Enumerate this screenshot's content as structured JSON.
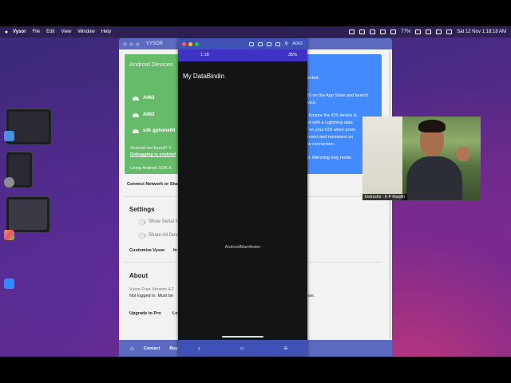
{
  "menubar": {
    "app": "Vysor",
    "items": [
      "File",
      "Edit",
      "View",
      "Window",
      "Help"
    ],
    "battery": "77%",
    "datetime": "Sat 12 Nov  1:18:18 AM"
  },
  "vysor": {
    "window_title": "VYSOR",
    "devices_header": "Android Devices",
    "devices": [
      "A063",
      "A063",
      "sdk gphone64"
    ],
    "not_found": "Android not found? V",
    "debugging_link": "Debugging is enabled",
    "using_sdk": "Using Android SDK A",
    "ios_lines": [
      "nected.",
      "OS on the App Store and launch",
      "evice.",
      "? Ensure the iOS device is",
      "ted with a Lightning data",
      "r\" on your iOS when prom",
      "onnect and reconnect yo",
      "the connection.",
      "ed. Mirroring only mode."
    ],
    "connect_network": "Connect Network or Sha",
    "settings_header": "Settings",
    "settings": [
      "Show Serial N",
      "Share All Devi"
    ],
    "customize": "Customize Vysor",
    "customize_more": "In",
    "about_header": "About",
    "version": "Vysor Free Version 4.2",
    "login": "Not logged in. Must be",
    "login_tail": "nse.",
    "upgrade": "Upgrade to Pro",
    "upgrade_more": "Lo",
    "bottom": {
      "contact": "Contact",
      "buy": "Buy"
    }
  },
  "phone": {
    "device": "A063",
    "time": "1:18",
    "battery": "35%",
    "app_title": "My DataBindin",
    "center_text": "AndroidManifester"
  },
  "webcam": {
    "label": "Instructor : K P Ranjith"
  },
  "colors": {
    "vysor_blue": "#5c6bc0",
    "green_card": "#66bb6a",
    "blue_card": "#448aff",
    "phone_status": "#3f33c6"
  }
}
